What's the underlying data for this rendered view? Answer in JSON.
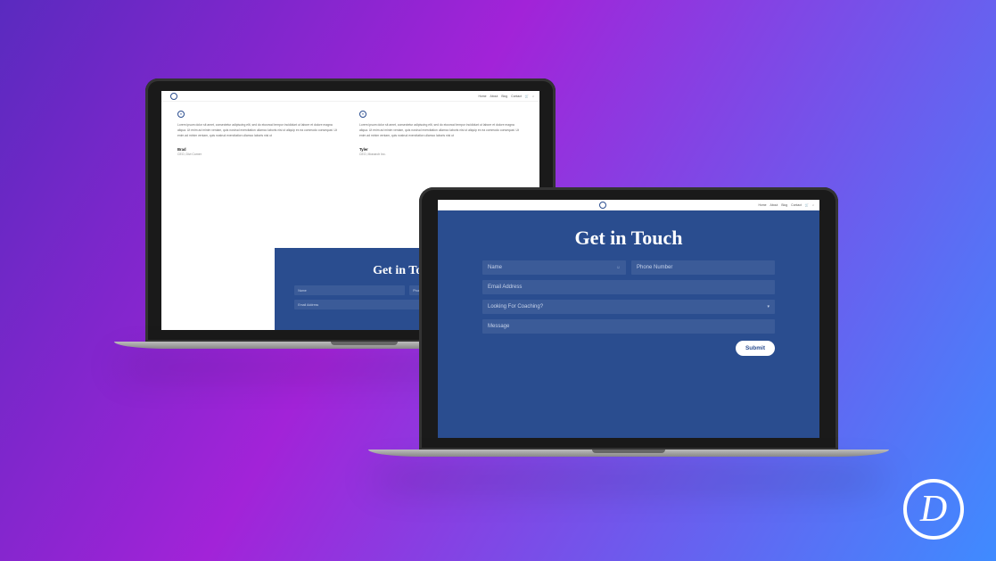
{
  "nav": {
    "home": "Home",
    "about": "About",
    "blog": "Blog",
    "contact": "Contact"
  },
  "testimonials": {
    "lorem": "Lorem ipsum dolor sit amet, consectetur adipiscing elit, sed do eiusmod tempor incididunt ut labore et dolore magna aliqua. Ut enim ad minim veniam, quis nostrud exercitation ullamco laboris nisi ut aliquip ex ea commodo consequat. Ut enim ad minim veniam, quis nostrud exercitation ullamco laboris nisi ut",
    "t1": {
      "name": "Brad",
      "title": "CEO, Divi Corner"
    },
    "t2": {
      "name": "Tyler",
      "title": "CEO, Monarch Inc."
    }
  },
  "contact": {
    "heading": "Get in Touch",
    "name": "Name",
    "phone": "Phone Number",
    "email": "Email Address",
    "coaching": "Looking For Coaching?",
    "message": "Message",
    "submit": "Submit"
  },
  "badge": "D"
}
